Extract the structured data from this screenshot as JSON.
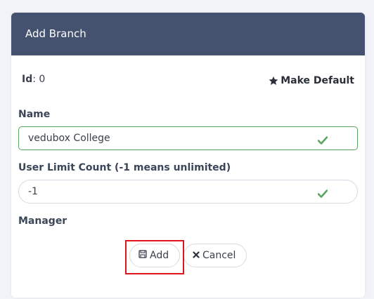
{
  "dialog": {
    "title": "Add Branch",
    "id_label": "Id",
    "id_value": ": 0",
    "make_default_label": "Make Default"
  },
  "form": {
    "name_label": "Name",
    "name_value": "vedubox College",
    "user_limit_label": "User Limit Count (-1 means unlimited)",
    "user_limit_value": "-1",
    "manager_label": "Manager"
  },
  "buttons": {
    "add_label": "Add",
    "cancel_label": "Cancel"
  },
  "colors": {
    "header_bg": "#44526f",
    "valid_green": "#5aa55e",
    "highlight_red": "#e0141a"
  },
  "icons": {
    "make_default": "star-icon",
    "valid": "check-icon",
    "add": "save-icon",
    "cancel": "close-icon"
  }
}
